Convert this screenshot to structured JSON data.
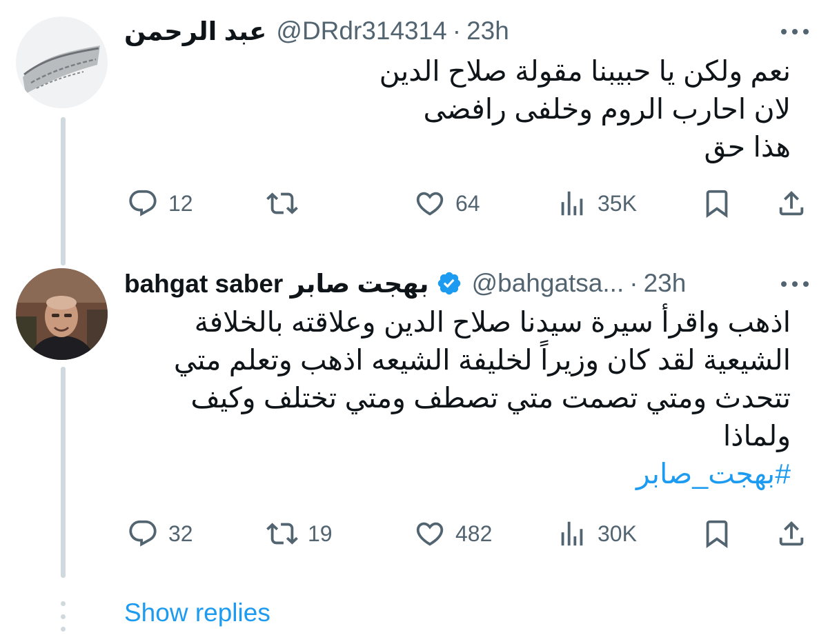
{
  "tweets": [
    {
      "display_name": "عبد الرحمن",
      "handle": "@DRdr314314",
      "separator": "·",
      "time": "23h",
      "lines": [
        "نعم ولكن يا حبيبنا مقولة صلاح الدين",
        "لان احارب الروم وخلفى رافضى",
        "هذا حق"
      ],
      "hashtag": "",
      "replies": "12",
      "retweets": "",
      "likes": "64",
      "views": "35K",
      "verified": false,
      "avatar_icon": "flag-avatar-icon"
    },
    {
      "display_name": "bahgat saber بهجت صابر",
      "handle": "@bahgatsa...",
      "separator": "·",
      "time": "23h",
      "lines": [
        "اذهب واقرأ سيرة سيدنا صلاح الدين وعلاقته بالخلافة",
        "الشيعية لقد كان وزيراً لخليفة الشيعه اذهب وتعلم متي",
        "تتحدث ومتي تصمت متي تصطف ومتي تختلف وكيف",
        "ولماذا"
      ],
      "hashtag": "#بهجت_صابر",
      "replies": "32",
      "retweets": "19",
      "likes": "482",
      "views": "30K",
      "verified": true,
      "verified_color": "#1d9bf0",
      "avatar_icon": "profile-photo-avatar-icon"
    }
  ],
  "show_replies": "Show replies",
  "colors": {
    "accent": "#1d9bf0",
    "secondary_text": "#536471",
    "thread_line": "#cfd9de"
  }
}
